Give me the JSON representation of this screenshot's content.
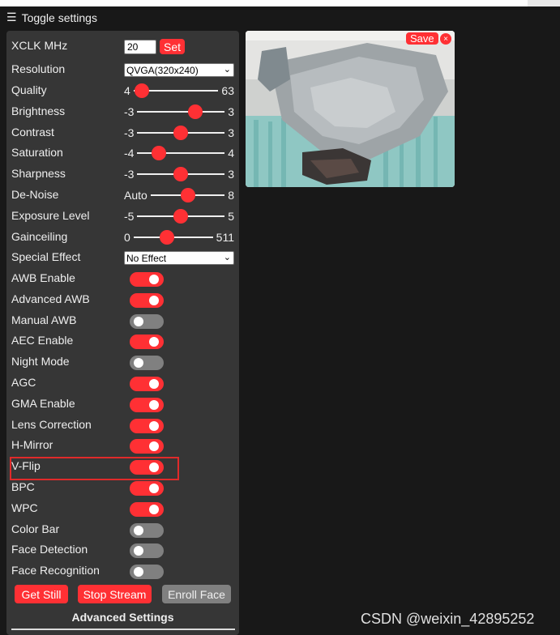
{
  "header": {
    "menu_icon": "hamburger-icon",
    "title": "Toggle settings"
  },
  "xclk": {
    "label": "XCLK MHz",
    "value": "20",
    "button": "Set"
  },
  "resolution": {
    "label": "Resolution",
    "value": "QVGA(320x240)"
  },
  "sliders": {
    "quality": {
      "label": "Quality",
      "min": "4",
      "max": "63",
      "value": 10
    },
    "brightness": {
      "label": "Brightness",
      "min": "-3",
      "max": "3",
      "value": 1
    },
    "contrast": {
      "label": "Contrast",
      "min": "-3",
      "max": "3",
      "value": 0
    },
    "saturation": {
      "label": "Saturation",
      "min": "-4",
      "max": "4",
      "value": -2
    },
    "sharpness": {
      "label": "Sharpness",
      "min": "-3",
      "max": "3",
      "value": 0
    },
    "denoise": {
      "label": "De-Noise",
      "min": "Auto",
      "max": "8",
      "value": 0.5
    },
    "exposure": {
      "label": "Exposure Level",
      "min": "-5",
      "max": "5",
      "value": 0
    },
    "gainceiling": {
      "label": "Gainceiling",
      "min": "0",
      "max": "511",
      "value": 0.42
    }
  },
  "special_effect": {
    "label": "Special Effect",
    "value": "No Effect"
  },
  "toggles": {
    "awb": {
      "label": "AWB Enable",
      "on": true
    },
    "aawb": {
      "label": "Advanced AWB",
      "on": true
    },
    "mawb": {
      "label": "Manual AWB",
      "on": false
    },
    "aec": {
      "label": "AEC Enable",
      "on": true
    },
    "night": {
      "label": "Night Mode",
      "on": false
    },
    "agc": {
      "label": "AGC",
      "on": true
    },
    "gma": {
      "label": "GMA Enable",
      "on": true
    },
    "lens": {
      "label": "Lens Correction",
      "on": true
    },
    "hmirror": {
      "label": "H-Mirror",
      "on": true
    },
    "vflip": {
      "label": "V-Flip",
      "on": true
    },
    "bpc": {
      "label": "BPC",
      "on": true
    },
    "wpc": {
      "label": "WPC",
      "on": true
    },
    "colorbar": {
      "label": "Color Bar",
      "on": false
    },
    "facedet": {
      "label": "Face Detection",
      "on": false
    },
    "facerec": {
      "label": "Face Recognition",
      "on": false
    }
  },
  "buttons": {
    "get_still": "Get Still",
    "stop_stream": "Stop Stream",
    "enroll_face": "Enroll Face"
  },
  "advanced_title": "Advanced Settings",
  "stream": {
    "save": "Save",
    "close": "×"
  },
  "watermark": "CSDN @weixin_42895252",
  "colors": {
    "accent": "#ff3034",
    "panel": "#363636",
    "background": "#181818",
    "highlight": "#e02a2a"
  }
}
